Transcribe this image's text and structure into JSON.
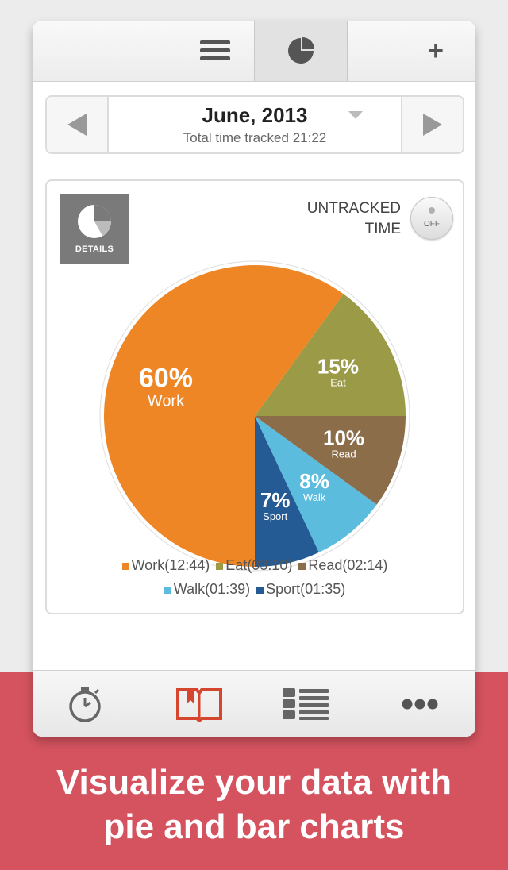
{
  "topbar": {
    "plus_label": "+"
  },
  "header": {
    "month": "June, 2013",
    "total_tracked": "Total time tracked 21:22"
  },
  "details_label": "DETAILS",
  "untracked": {
    "line1": "UNTRACKED",
    "line2": "TIME",
    "toggle_state": "OFF"
  },
  "chart_data": {
    "type": "pie",
    "slices": [
      {
        "name": "Work",
        "percent": 60,
        "value": "12:44",
        "color": "#ef8626",
        "label": "60%"
      },
      {
        "name": "Eat",
        "percent": 15,
        "value": "03:10",
        "color": "#9b9a47",
        "label": "15%"
      },
      {
        "name": "Read",
        "percent": 10,
        "value": "02:14",
        "color": "#8c6d49",
        "label": "10%"
      },
      {
        "name": "Walk",
        "percent": 8,
        "value": "01:39",
        "color": "#5bbcdd",
        "label": "8%"
      },
      {
        "name": "Sport",
        "percent": 7,
        "value": "01:35",
        "color": "#255b94",
        "label": "7%"
      }
    ]
  },
  "legend": [
    {
      "text": "Work(12:44)",
      "color": "#ef8626"
    },
    {
      "text": "Eat(03:10)",
      "color": "#9b9a47"
    },
    {
      "text": "Read(02:14)",
      "color": "#8c6d49"
    },
    {
      "text": "Walk(01:39)",
      "color": "#5bbcdd"
    },
    {
      "text": "Sport(01:35)",
      "color": "#255b94"
    }
  ],
  "colors": {
    "accent": "#d4535f",
    "active_tab": "#d6452e"
  },
  "tabs": [
    {
      "icon": "stopwatch-icon"
    },
    {
      "icon": "book-icon"
    },
    {
      "icon": "list-icon"
    },
    {
      "icon": "more-icon"
    }
  ],
  "headline": {
    "line1": "Visualize your data with",
    "line2": "pie and bar charts"
  }
}
